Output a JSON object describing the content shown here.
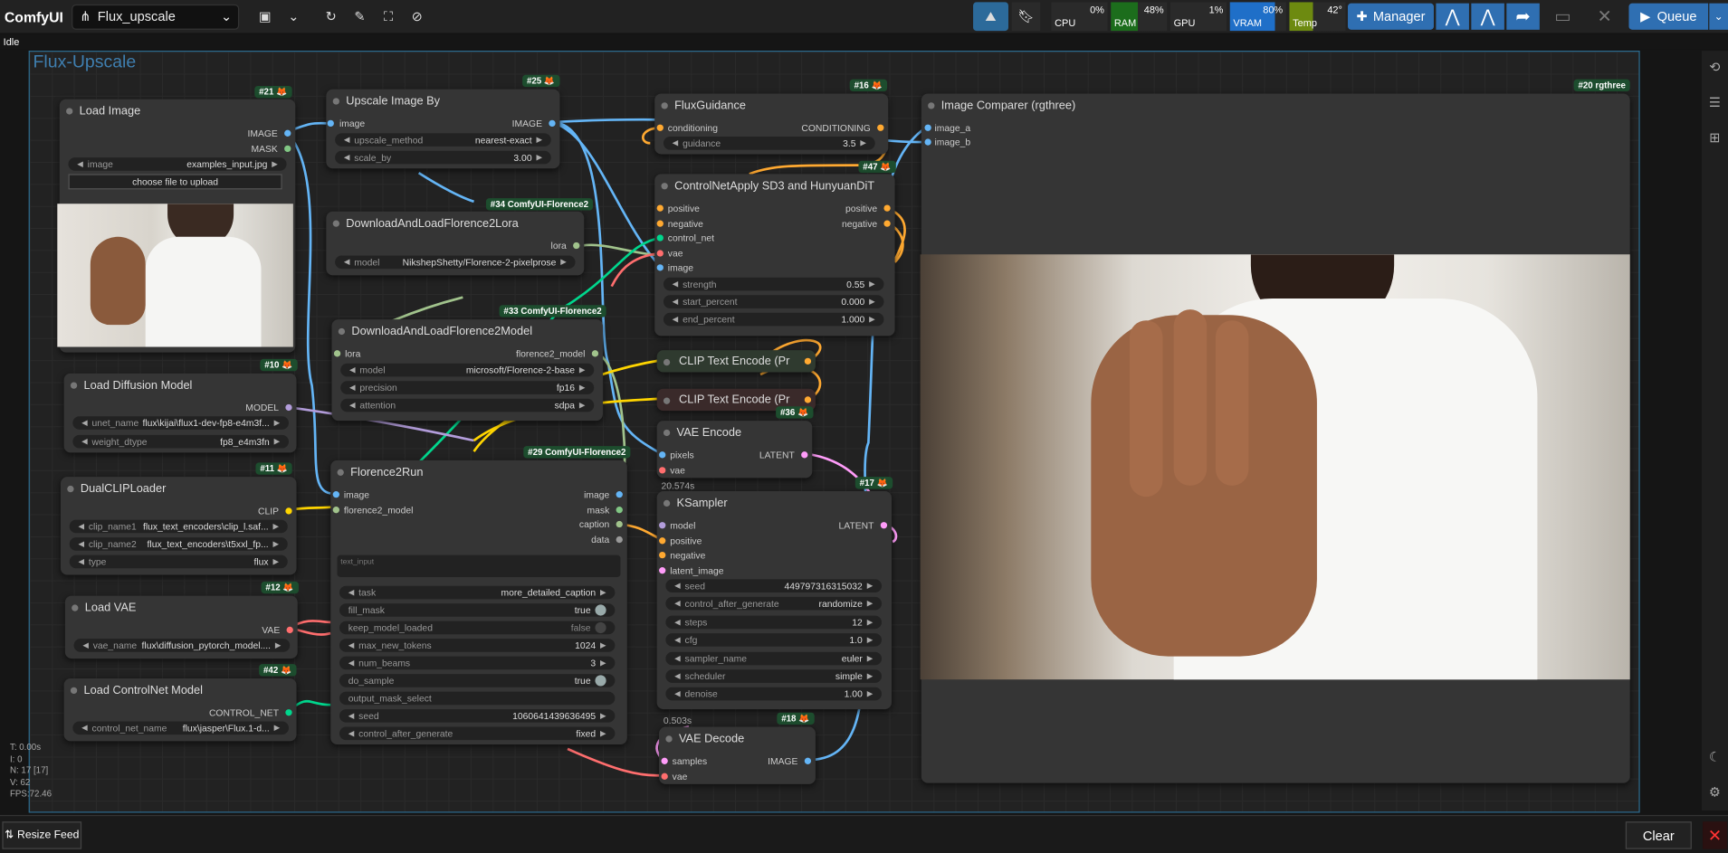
{
  "app": {
    "name": "ComfyUI",
    "workflow": "Flux_upscale",
    "status": "Idle",
    "queue_label": "Queue",
    "manager_label": "Manager"
  },
  "monitor": {
    "cpu_label": "CPU",
    "cpu": "0%",
    "ram_label": "RAM",
    "ram": "48%",
    "gpu_label": "GPU",
    "gpu": "1%",
    "vram_label": "VRAM",
    "vram": "80%",
    "temp_label": "Temp",
    "temp": "42°"
  },
  "group": {
    "title": "Flux-Upscale"
  },
  "nodes": {
    "load_image": {
      "badge": "#21",
      "title": "Load Image",
      "out_image": "IMAGE",
      "out_mask": "MASK",
      "w_image_l": "image",
      "w_image_v": "examples_input.jpg",
      "upload": "choose file to upload"
    },
    "upscale": {
      "badge": "#25",
      "title": "Upscale Image By",
      "in_image": "image",
      "out_image": "IMAGE",
      "w1_l": "upscale_method",
      "w1_v": "nearest-exact",
      "w2_l": "scale_by",
      "w2_v": "3.00"
    },
    "flux_guidance": {
      "badge": "#16",
      "title": "FluxGuidance",
      "in": "conditioning",
      "out": "CONDITIONING",
      "w_l": "guidance",
      "w_v": "3.5"
    },
    "comparer": {
      "badge": "#20 rgthree",
      "title": "Image Comparer (rgthree)",
      "a": "image_a",
      "b": "image_b"
    },
    "dl_lora": {
      "badge": "#34 ComfyUI-Florence2",
      "title": "DownloadAndLoadFlorence2Lora",
      "out": "lora",
      "w_l": "model",
      "w_v": "NikshepShetty/Florence-2-pixelprose"
    },
    "controlnet_apply": {
      "badge": "#47",
      "title": "ControlNetApply SD3 and HunyuanDiT",
      "in1": "positive",
      "in2": "negative",
      "in3": "control_net",
      "in4": "vae",
      "in5": "image",
      "out1": "positive",
      "out2": "negative",
      "w1_l": "strength",
      "w1_v": "0.55",
      "w2_l": "start_percent",
      "w2_v": "0.000",
      "w3_l": "end_percent",
      "w3_v": "1.000"
    },
    "dl_model": {
      "badge": "#33 ComfyUI-Florence2",
      "title": "DownloadAndLoadFlorence2Model",
      "in": "lora",
      "out": "florence2_model",
      "w1_l": "model",
      "w1_v": "microsoft/Florence-2-base",
      "w2_l": "precision",
      "w2_v": "fp16",
      "w3_l": "attention",
      "w3_v": "sdpa"
    },
    "clip1": {
      "title": "CLIP Text Encode (Pr"
    },
    "clip2": {
      "title": "CLIP Text Encode (Pr"
    },
    "load_diff": {
      "badge": "#10",
      "title": "Load Diffusion Model",
      "out": "MODEL",
      "w1_l": "unet_name",
      "w1_v": "flux\\kijai\\flux1-dev-fp8-e4m3f...",
      "w2_l": "weight_dtype",
      "w2_v": "fp8_e4m3fn"
    },
    "vae_encode": {
      "badge": "#36",
      "title": "VAE Encode",
      "in1": "pixels",
      "in2": "vae",
      "out": "LATENT",
      "time": "20.574s"
    },
    "dualclip": {
      "badge": "#11",
      "title": "DualCLIPLoader",
      "out": "CLIP",
      "w1_l": "clip_name1",
      "w1_v": "flux_text_encoders\\clip_l.saf...",
      "w2_l": "clip_name2",
      "w2_v": "flux_text_encoders\\t5xxl_fp...",
      "w3_l": "type",
      "w3_v": "flux"
    },
    "florence_run": {
      "badge": "#29 ComfyUI-Florence2",
      "title": "Florence2Run",
      "in1": "image",
      "in2": "florence2_model",
      "out1": "image",
      "out2": "mask",
      "out3": "caption",
      "out4": "data",
      "text_ph": "text_input",
      "task_l": "task",
      "task_v": "more_detailed_caption",
      "fill_l": "fill_mask",
      "fill_v": "true",
      "keep_l": "keep_model_loaded",
      "keep_v": "false",
      "max_l": "max_new_tokens",
      "max_v": "1024",
      "beams_l": "num_beams",
      "beams_v": "3",
      "sample_l": "do_sample",
      "sample_v": "true",
      "omask_l": "output_mask_select",
      "seed_l": "seed",
      "seed_v": "1060641439636495",
      "cag_l": "control_after_generate",
      "cag_v": "fixed"
    },
    "ksampler": {
      "badge": "#17",
      "title": "KSampler",
      "in1": "model",
      "in2": "positive",
      "in3": "negative",
      "in4": "latent_image",
      "out": "LATENT",
      "seed_l": "seed",
      "seed_v": "449797316315032",
      "cag_l": "control_after_generate",
      "cag_v": "randomize",
      "steps_l": "steps",
      "steps_v": "12",
      "cfg_l": "cfg",
      "cfg_v": "1.0",
      "sampler_l": "sampler_name",
      "sampler_v": "euler",
      "sched_l": "scheduler",
      "sched_v": "simple",
      "denoise_l": "denoise",
      "denoise_v": "1.00",
      "time": "0.503s"
    },
    "load_vae": {
      "badge": "#12",
      "title": "Load VAE",
      "out": "VAE",
      "w_l": "vae_name",
      "w_v": "flux\\diffusion_pytorch_model...."
    },
    "load_cn": {
      "badge": "#42",
      "title": "Load ControlNet Model",
      "out": "CONTROL_NET",
      "w_l": "control_net_name",
      "w_v": "flux\\jasper\\Flux.1-d..."
    },
    "vae_decode": {
      "badge": "#18",
      "title": "VAE Decode",
      "in1": "samples",
      "in2": "vae",
      "out": "IMAGE"
    }
  },
  "stats": {
    "t": "T: 0.00s",
    "i": "I: 0",
    "n": "N: 17 [17]",
    "v": "V: 62",
    "fps": "FPS:72.46"
  },
  "footer": {
    "resize": "Resize Feed",
    "clear": "Clear"
  },
  "colors": {
    "accent": "#1f6fb5",
    "image": "#64b5f6",
    "model": "#b39ddb",
    "clip": "#ffd500",
    "vae": "#ff6e6e",
    "latent": "#ff9cf9",
    "cond": "#ffa931",
    "controlnet": "#00d78d",
    "florence": "#a1c38c"
  }
}
